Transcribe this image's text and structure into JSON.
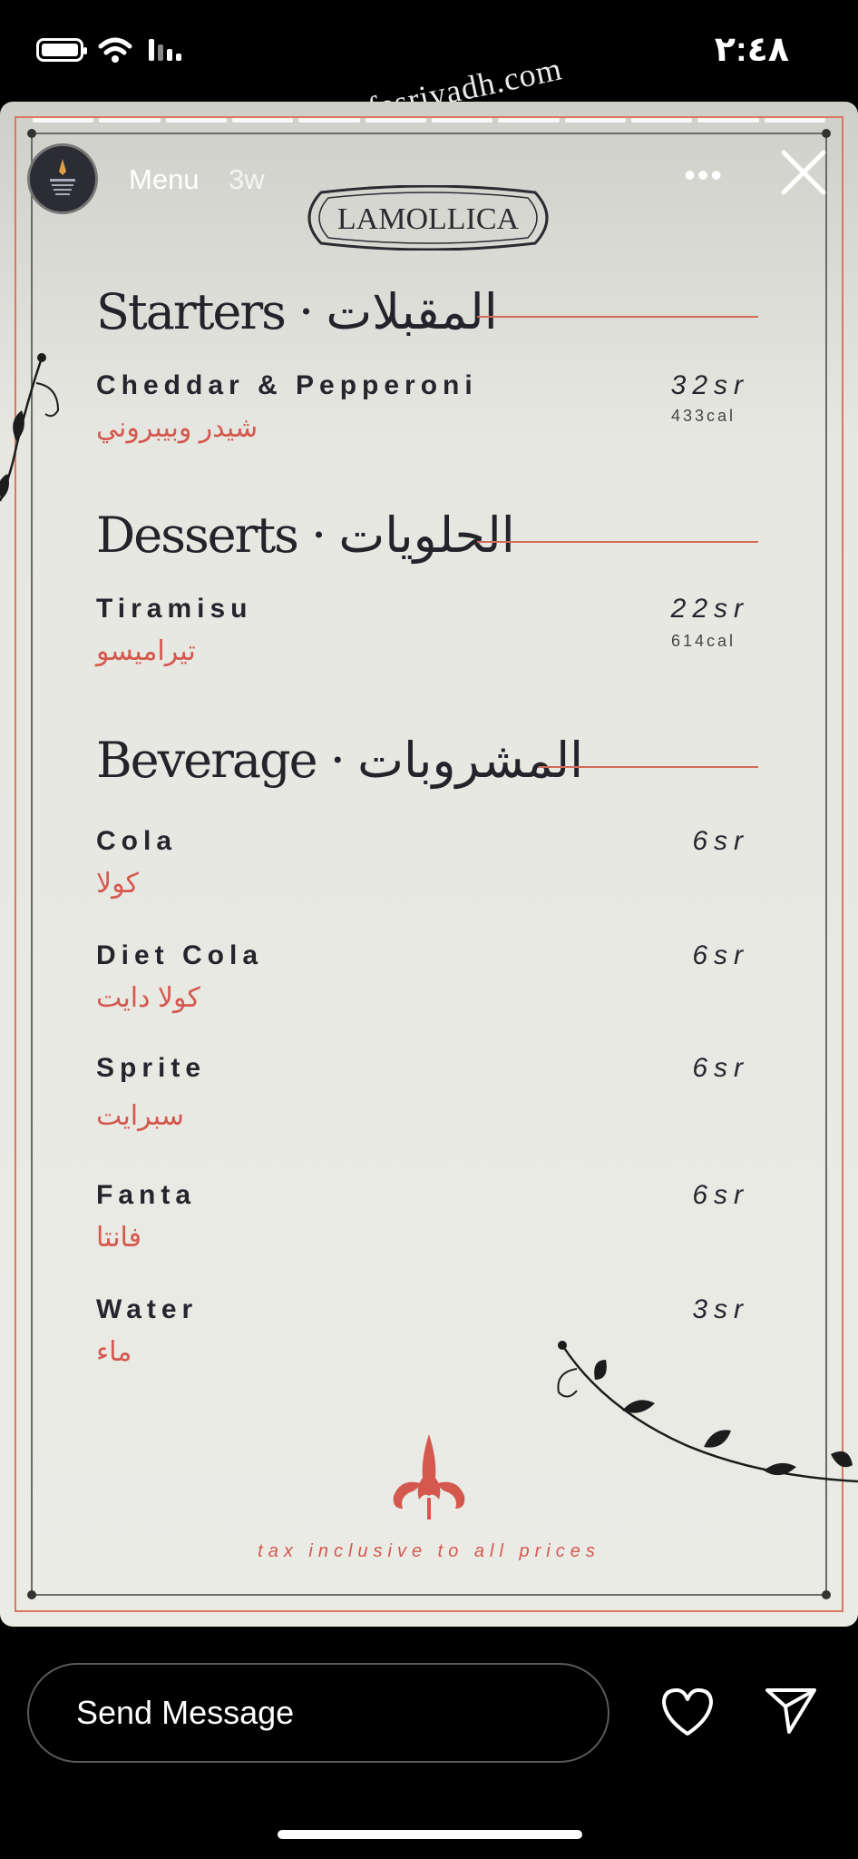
{
  "status": {
    "time": "٢:٤٨",
    "watermark": "cafesriyadh.com"
  },
  "story": {
    "account": "Menu",
    "age": "3w",
    "more": "•••",
    "logo_text": "LAMOLLICA",
    "progress_segments": 12,
    "icons": {
      "avatar": "lamp-logo-icon",
      "close": "close-icon",
      "more": "more-icon"
    }
  },
  "menu": {
    "sections": [
      {
        "title": "Starters · المقبلات",
        "items": [
          {
            "en": "Cheddar & Pepperoni",
            "ar": "شيدر وبيبروني",
            "price": "32sr",
            "cal": "433cal"
          }
        ]
      },
      {
        "title": "Desserts · الحلويات",
        "items": [
          {
            "en": "Tiramisu",
            "ar": "تيراميسو",
            "price": "22sr",
            "cal": "614cal"
          }
        ]
      },
      {
        "title": "Beverage · المشروبات",
        "items": [
          {
            "en": "Cola",
            "ar": "كولا",
            "price": "6sr"
          },
          {
            "en": "Diet Cola",
            "ar": "كولا دايت",
            "price": "6sr"
          },
          {
            "en": "Sprite",
            "ar": "سبرايت",
            "price": "6sr"
          },
          {
            "en": "Fanta",
            "ar": "فانتا",
            "price": "6sr"
          },
          {
            "en": "Water",
            "ar": "ماء",
            "price": "3sr"
          }
        ]
      }
    ],
    "footer_note": "tax inclusive to all prices"
  },
  "reply": {
    "placeholder": "Send Message",
    "icons": {
      "like": "heart-icon",
      "share": "send-icon"
    }
  },
  "colors": {
    "accent": "#d4584e",
    "text": "#25252e",
    "paper": "#ebebe6"
  }
}
